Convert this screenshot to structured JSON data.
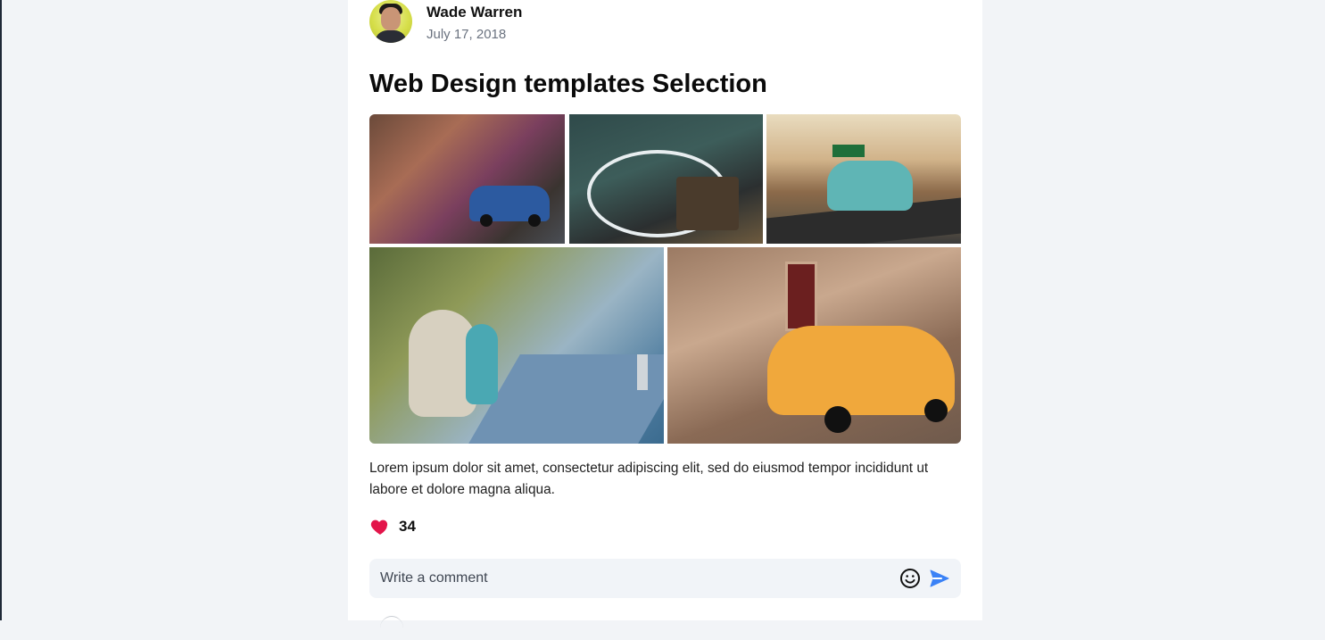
{
  "post": {
    "author": {
      "name": "Wade Warren",
      "date": "July 17, 2018"
    },
    "title": "Web Design templates Selection",
    "text": "Lorem ipsum dolor sit amet, consectetur adipiscing elit, sed do eiusmod tempor incididunt ut labore et dolore magna aliqua.",
    "likes": {
      "count": "34",
      "icon": "heart-icon",
      "color": "#e3154a"
    },
    "gallery": [
      {
        "name": "photo-street-cars"
      },
      {
        "name": "photo-bicycle-shop"
      },
      {
        "name": "photo-teal-car-road"
      },
      {
        "name": "photo-scooters-sidewalk"
      },
      {
        "name": "photo-yellow-car"
      }
    ]
  },
  "comment": {
    "placeholder": "Write a comment",
    "emoji_icon": "smiley-icon",
    "send_icon": "send-icon",
    "accent": "#3b82f6"
  }
}
